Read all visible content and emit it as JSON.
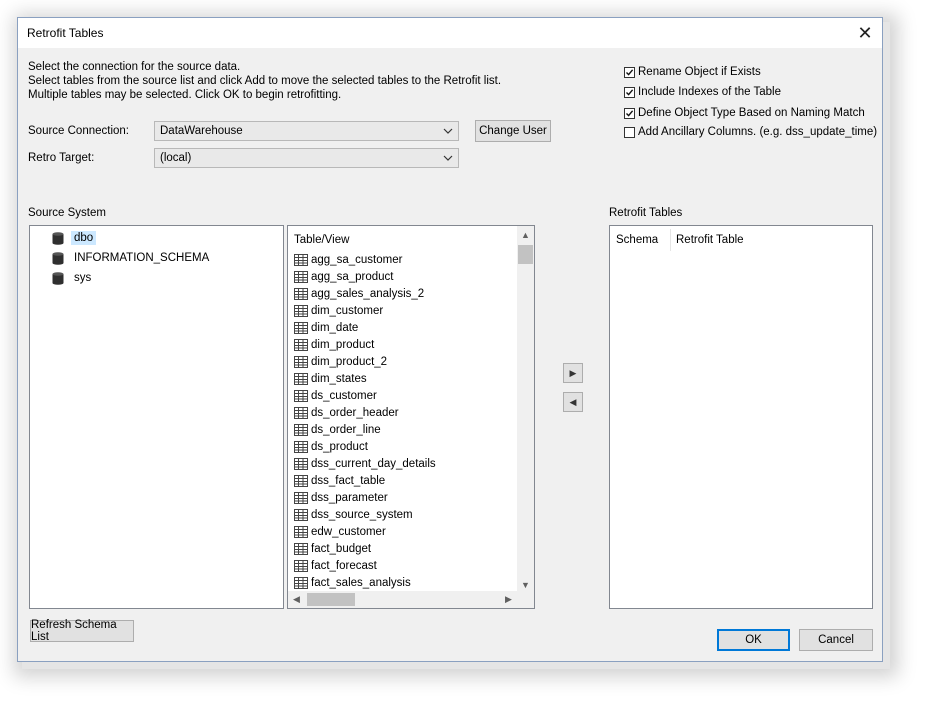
{
  "window": {
    "title": "Retrofit Tables",
    "close_glyph": "✕"
  },
  "instructions": {
    "line1": "Select the connection for the source data.",
    "line2": "Select tables from the source list and click Add to move the selected tables to the Retrofit list.",
    "line3": "Multiple tables may be selected. Click OK to begin retrofitting."
  },
  "source_connection": {
    "label": "Source Connection:",
    "value": "DataWarehouse"
  },
  "retro_target": {
    "label": "Retro Target:",
    "value": "(local)"
  },
  "change_user_label": "Change User",
  "options": [
    {
      "label": "Rename Object if Exists",
      "checked": true
    },
    {
      "label": "Include Indexes of the Table",
      "checked": true
    },
    {
      "label": "Define Object Type Based on Naming Match",
      "checked": true
    },
    {
      "label": "Add Ancillary Columns. (e.g. dss_update_time)",
      "checked": false
    }
  ],
  "source_system": {
    "label": "Source System",
    "schemas": [
      {
        "name": "dbo",
        "selected": true
      },
      {
        "name": "INFORMATION_SCHEMA",
        "selected": false
      },
      {
        "name": "sys",
        "selected": false
      }
    ]
  },
  "table_list": {
    "header": "Table/View",
    "items": [
      "agg_sa_customer",
      "agg_sa_product",
      "agg_sales_analysis_2",
      "dim_customer",
      "dim_date",
      "dim_product",
      "dim_product_2",
      "dim_states",
      "ds_customer",
      "ds_order_header",
      "ds_order_line",
      "ds_product",
      "dss_current_day_details",
      "dss_fact_table",
      "dss_parameter",
      "dss_source_system",
      "edw_customer",
      "fact_budget",
      "fact_forecast",
      "fact_sales_analysis"
    ]
  },
  "move_buttons": {
    "add": "▶",
    "remove": "◀"
  },
  "retrofit_tables": {
    "label": "Retrofit Tables",
    "columns": [
      "Schema",
      "Retrofit Table"
    ]
  },
  "refresh_label": "Refresh Schema List",
  "ok_label": "OK",
  "cancel_label": "Cancel",
  "colors": {
    "selection": "#cce8ff",
    "primary_border": "#0078d7",
    "dialog_bg": "#f0f0f0"
  }
}
